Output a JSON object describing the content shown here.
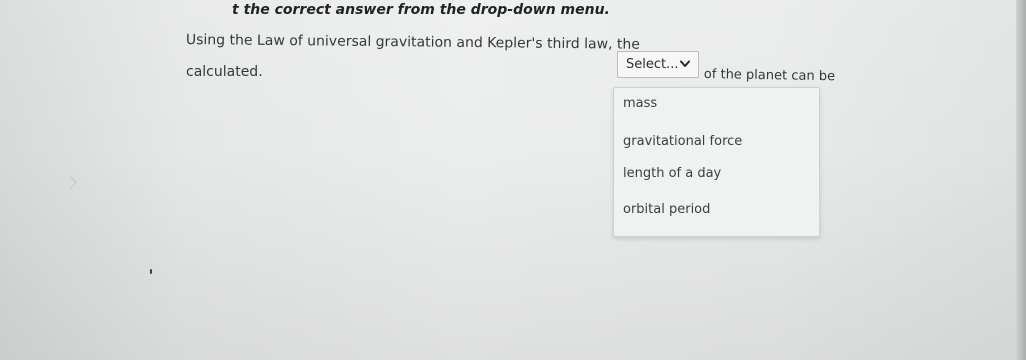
{
  "instruction": "t the correct answer from the drop-down menu.",
  "question": {
    "line1": "Using the Law of universal gravitation and Kepler's third law, the",
    "line2": "calculated.",
    "suffix": "of the planet can be"
  },
  "select": {
    "selected_label": "Select...",
    "icon": "chevron-down-icon"
  },
  "dropdown": {
    "options": [
      "mass",
      "gravitational force",
      "length of a day",
      "orbital period"
    ]
  }
}
